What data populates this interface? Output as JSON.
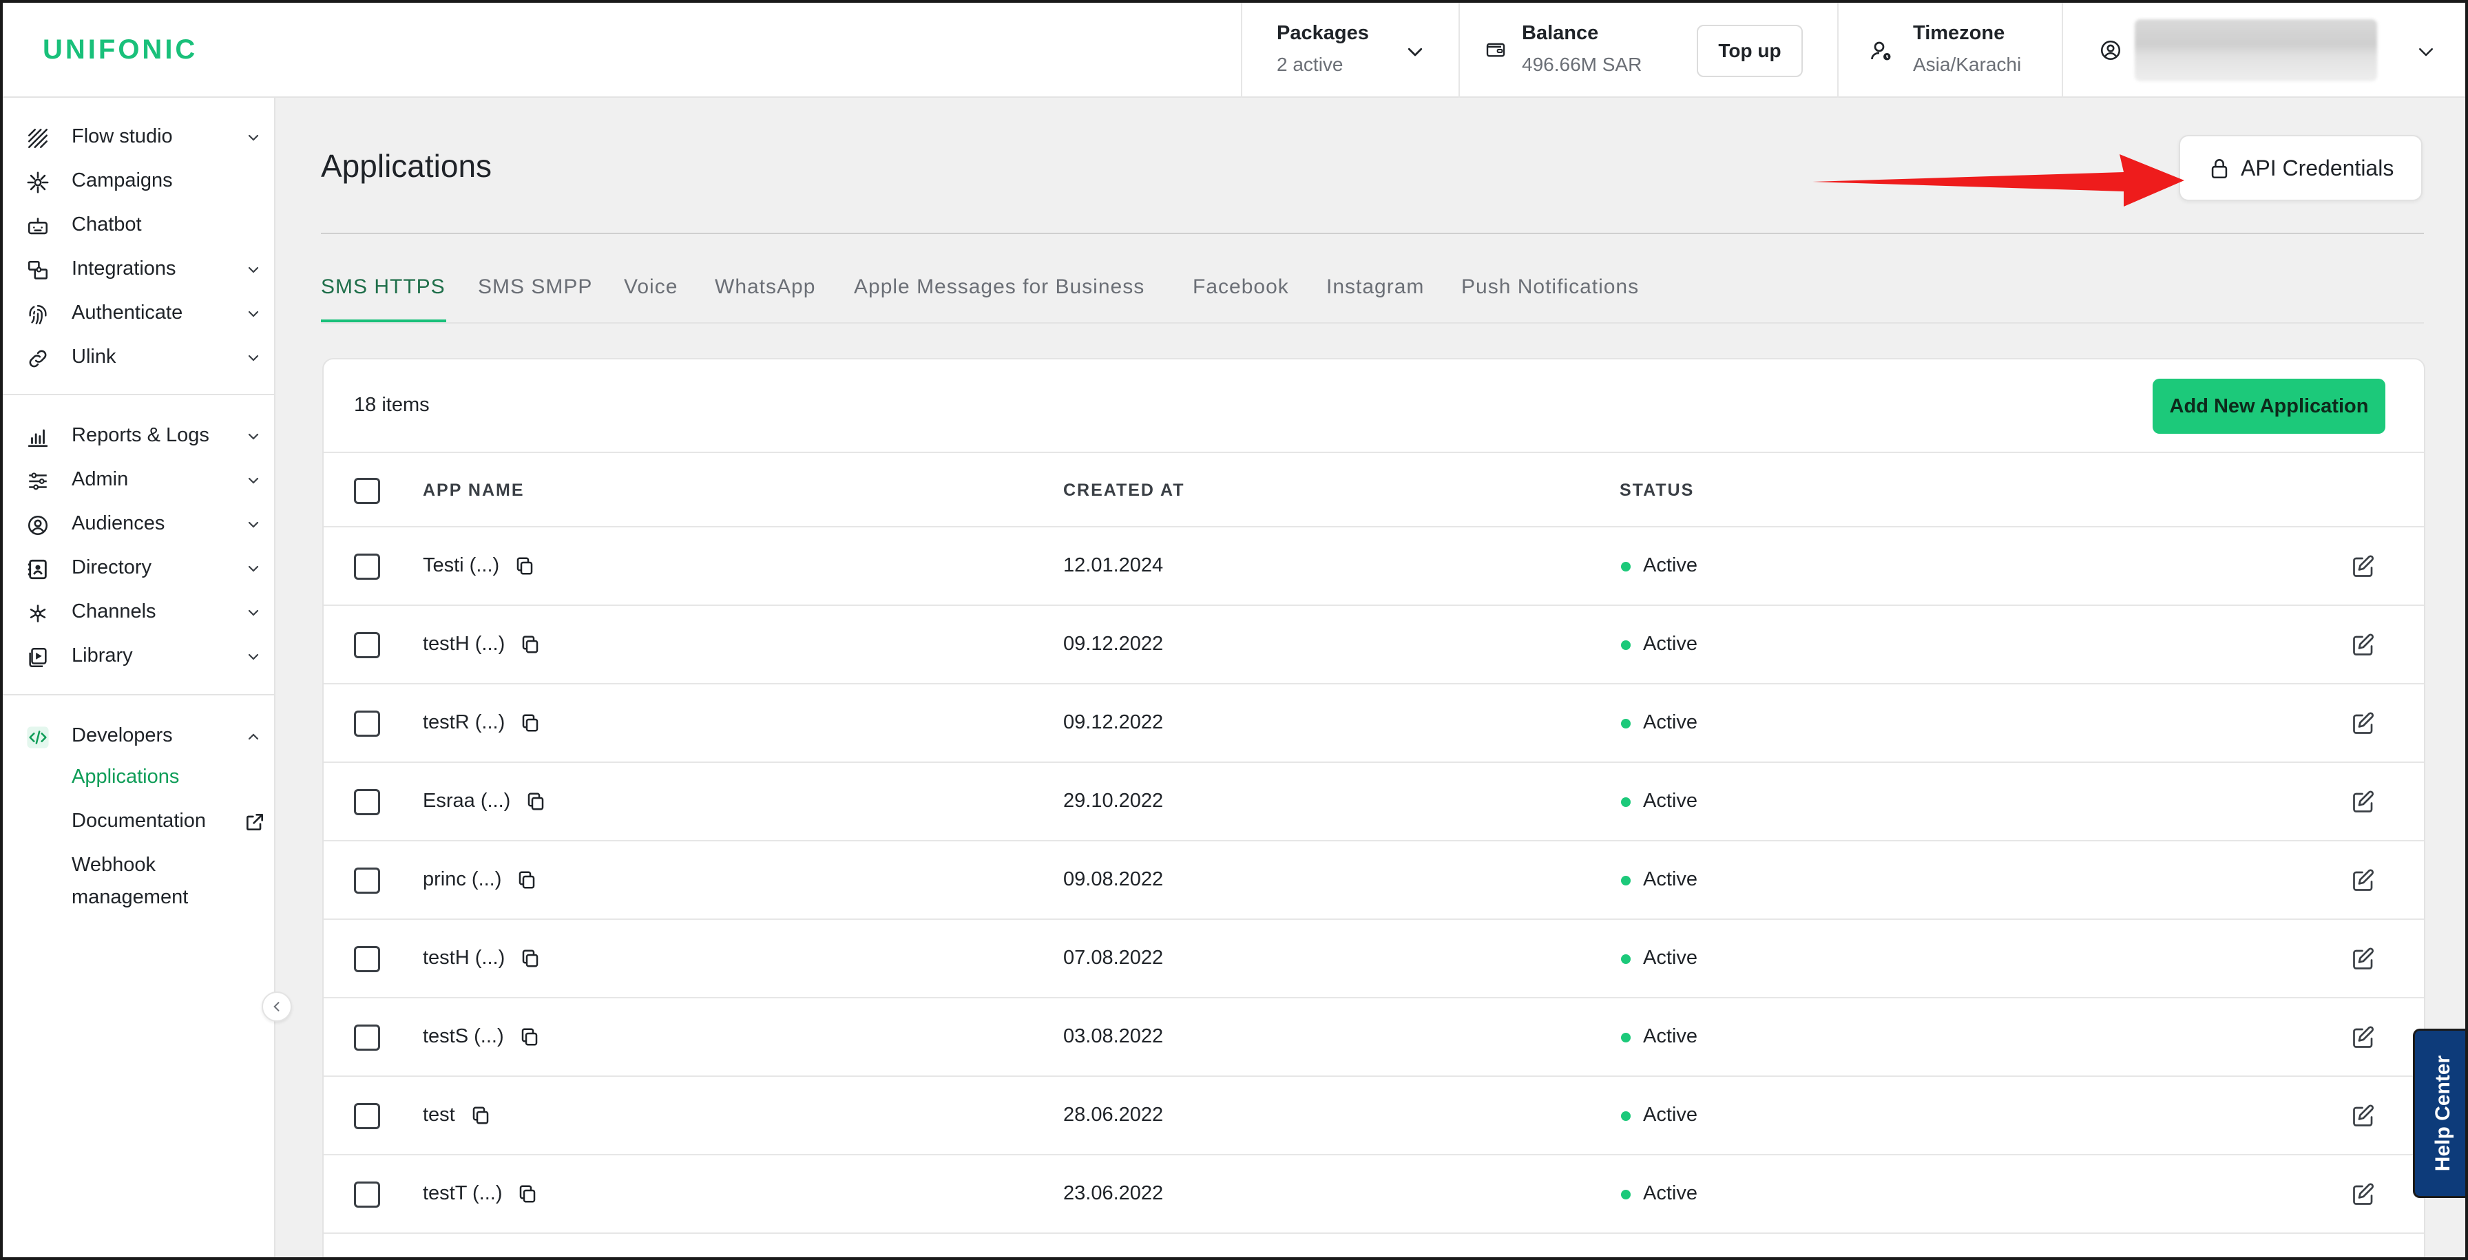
{
  "app": {
    "logo": "UNIFONIC",
    "brand_color": "#19c07a"
  },
  "topbar": {
    "packages": {
      "title": "Packages",
      "value": "2 active"
    },
    "balance": {
      "title": "Balance",
      "value": "496.66M SAR",
      "topup_label": "Top up"
    },
    "timezone": {
      "title": "Timezone",
      "value": "Asia/Karachi"
    }
  },
  "sidebar": {
    "items": [
      {
        "label": "Flow studio",
        "icon": "flow-icon"
      },
      {
        "label": "Campaigns",
        "icon": "burst-icon"
      },
      {
        "label": "Chatbot",
        "icon": "robot-icon"
      },
      {
        "label": "Integrations",
        "icon": "puzzle-icon"
      },
      {
        "label": "Authenticate",
        "icon": "fingerprint-icon"
      },
      {
        "label": "Ulink",
        "icon": "link-icon"
      },
      {
        "label": "Reports & Logs",
        "icon": "chart-icon"
      },
      {
        "label": "Admin",
        "icon": "sliders-icon"
      },
      {
        "label": "Audiences",
        "icon": "user-circle-icon"
      },
      {
        "label": "Directory",
        "icon": "contact-book-icon"
      },
      {
        "label": "Channels",
        "icon": "network-icon"
      },
      {
        "label": "Library",
        "icon": "library-icon"
      },
      {
        "label": "Developers",
        "icon": "code-icon"
      }
    ],
    "developers_sub": {
      "applications": "Applications",
      "documentation": "Documentation",
      "webhook_line1": "Webhook",
      "webhook_line2": "management"
    }
  },
  "main": {
    "title": "Applications",
    "api_credentials_label": "API Credentials",
    "tabs": [
      "SMS HTTPS",
      "SMS SMPP",
      "Voice",
      "WhatsApp",
      "Apple Messages for Business",
      "Facebook",
      "Instagram",
      "Push Notifications"
    ],
    "active_tab": "SMS HTTPS",
    "items_count": "18 items",
    "add_button_label": "Add New Application",
    "columns": {
      "app_name": "APP NAME",
      "created_at": "CREATED AT",
      "status": "STATUS"
    },
    "rows": [
      {
        "name": "Testi (...)",
        "created": "12.01.2024",
        "status": "Active"
      },
      {
        "name": "testH (...)",
        "created": "09.12.2022",
        "status": "Active"
      },
      {
        "name": "testR (...)",
        "created": "09.12.2022",
        "status": "Active"
      },
      {
        "name": "Esraa (...)",
        "created": "29.10.2022",
        "status": "Active"
      },
      {
        "name": "princ (...)",
        "created": "09.08.2022",
        "status": "Active"
      },
      {
        "name": "testH (...)",
        "created": "07.08.2022",
        "status": "Active"
      },
      {
        "name": "testS (...)",
        "created": "03.08.2022",
        "status": "Active"
      },
      {
        "name": "test",
        "created": "28.06.2022",
        "status": "Active"
      },
      {
        "name": "testT (...)",
        "created": "23.06.2022",
        "status": "Active"
      }
    ],
    "status_color": "#1cc97a"
  },
  "help": {
    "label": "Help Center",
    "color": "#0d3b7a"
  },
  "annotation": {
    "arrow_color": "#ee1c1c"
  }
}
